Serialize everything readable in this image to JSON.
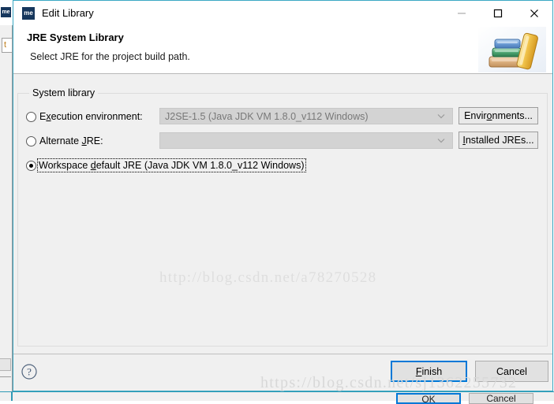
{
  "window": {
    "title": "Edit Library",
    "app_icon_text": "me",
    "controls": {
      "minimize": "minimize-icon",
      "maximize": "maximize-icon",
      "close": "close-icon"
    }
  },
  "header": {
    "title": "JRE System Library",
    "description": "Select JRE for the project build path.",
    "banner_icon": "books-icon"
  },
  "group": {
    "label": "System library",
    "options": [
      {
        "id": "execution-environment",
        "label_pre": "E",
        "label_mnemonic": "x",
        "label_post": "ecution environment:",
        "full_label": "Execution environment:",
        "selected": false,
        "combo_value": "J2SE-1.5 (Java JDK VM 1.8.0_v112 Windows)",
        "combo_enabled": false,
        "button_label_pre": "Envir",
        "button_mnemonic": "o",
        "button_label_post": "nments...",
        "button_full_label": "Environments..."
      },
      {
        "id": "alternate-jre",
        "label_pre": "Alternate ",
        "label_mnemonic": "J",
        "label_post": "RE:",
        "full_label": "Alternate JRE:",
        "selected": false,
        "combo_value": "",
        "combo_enabled": false,
        "button_label_pre": "",
        "button_mnemonic": "I",
        "button_label_post": "nstalled JREs...",
        "button_full_label": "Installed JREs..."
      },
      {
        "id": "workspace-default-jre",
        "label_pre": "Workspace ",
        "label_mnemonic": "d",
        "label_post": "efault JRE (Java JDK VM 1.8.0_v112 Windows)",
        "full_label": "Workspace default JRE (Java JDK VM 1.8.0_v112 Windows)",
        "selected": true,
        "focused": true
      }
    ]
  },
  "footer": {
    "help_icon": "question-mark-icon",
    "finish_pre": "F",
    "finish_mnemonic": "F",
    "finish_label": "Finish",
    "finish_label_post": "inish",
    "cancel_label": "Cancel"
  },
  "watermarks": {
    "center": "http://blog.csdn.net/a78270528",
    "bottom": "https://blog.csdn.net/sj1362255732"
  },
  "background": {
    "ok_label": "OK",
    "cancel_label": "Cancel",
    "left_icon_text": "me",
    "left_field_text": "t"
  },
  "colors": {
    "dialog_border": "#3ba8c4",
    "accent_focus": "#0078d7",
    "dialog_bg": "#f0f0f0",
    "header_bg": "#ffffff",
    "combo_disabled_bg": "#d3d3d3",
    "app_icon_bg": "#16365c",
    "watermark": "#dedede"
  }
}
